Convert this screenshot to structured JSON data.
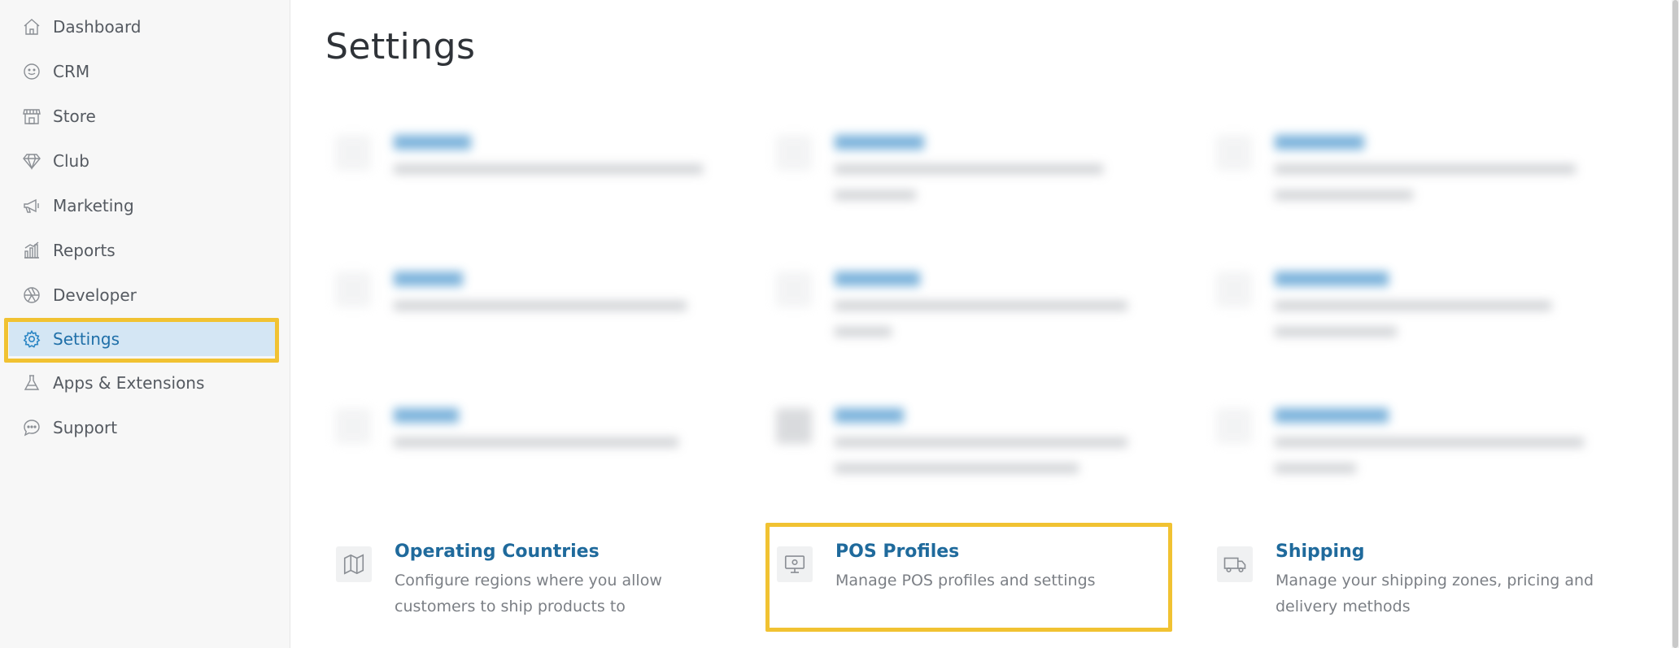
{
  "sidebar": {
    "items": [
      {
        "label": "Dashboard",
        "icon": "home-icon"
      },
      {
        "label": "CRM",
        "icon": "smiley-icon"
      },
      {
        "label": "Store",
        "icon": "storefront-icon"
      },
      {
        "label": "Club",
        "icon": "diamond-icon"
      },
      {
        "label": "Marketing",
        "icon": "megaphone-icon"
      },
      {
        "label": "Reports",
        "icon": "bar-chart-icon"
      },
      {
        "label": "Developer",
        "icon": "aperture-icon"
      },
      {
        "label": "Settings",
        "icon": "gear-icon",
        "active": true
      },
      {
        "label": "Apps & Extensions",
        "icon": "flask-icon"
      },
      {
        "label": "Support",
        "icon": "chat-bubble-icon"
      }
    ]
  },
  "page": {
    "title": "Settings"
  },
  "cards": [
    {
      "title": "Operating Countries",
      "description": "Configure regions where you allow customers to ship products to",
      "icon": "map-icon"
    },
    {
      "title": "POS Profiles",
      "description": "Manage POS profiles and settings",
      "icon": "monitor-icon"
    },
    {
      "title": "Shipping",
      "description": "Manage your shipping zones, pricing and delivery methods",
      "icon": "truck-icon"
    }
  ],
  "colors": {
    "accent": "#1f6a9c",
    "highlight": "#f1c232",
    "active_bg": "#d4e6f4"
  }
}
